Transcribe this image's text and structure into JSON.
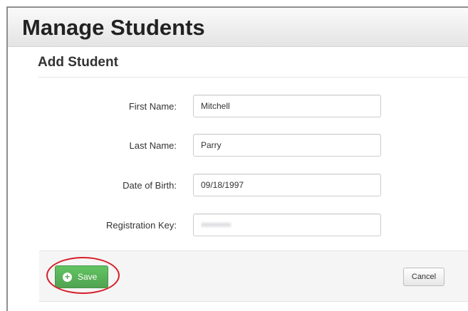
{
  "page": {
    "title": "Manage Students",
    "section_title": "Add Student"
  },
  "form": {
    "first_name": {
      "label": "First Name:",
      "value": "Mitchell"
    },
    "last_name": {
      "label": "Last Name:",
      "value": "Parry"
    },
    "date_of_birth": {
      "label": "Date of Birth:",
      "value": "09/18/1997"
    },
    "registration_key": {
      "label": "Registration Key:",
      "value": "••••••••••"
    }
  },
  "actions": {
    "save_label": "Save",
    "save_icon": "plus-circle-icon",
    "cancel_label": "Cancel"
  },
  "colors": {
    "save_green": "#51a351",
    "highlight_red": "#d61f2a"
  }
}
